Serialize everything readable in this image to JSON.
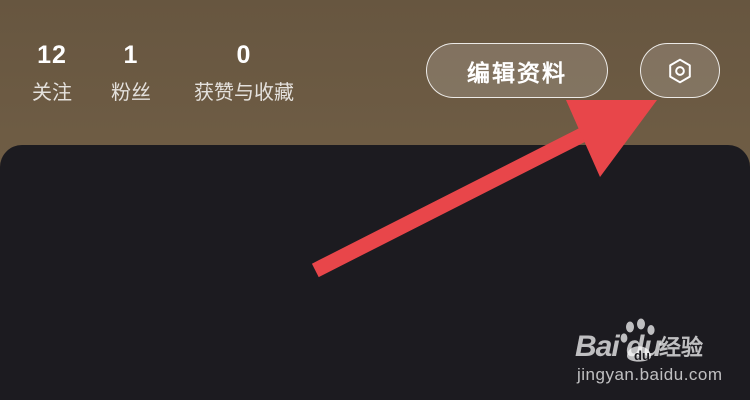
{
  "profile_stats": [
    {
      "count": "12",
      "label": "关注"
    },
    {
      "count": "1",
      "label": "粉丝"
    },
    {
      "count": "0",
      "label": "获赞与收藏"
    }
  ],
  "actions": {
    "edit_profile_label": "编辑资料",
    "settings_icon": "gear-icon"
  },
  "annotation": {
    "arrow_color": "#e8464a",
    "points_to": "settings-button"
  },
  "colors": {
    "header_background": "#6b5b44",
    "panel_background": "#1c1b20"
  },
  "watermark": {
    "logo_text": "Bai du",
    "product": "经验",
    "url": "jingyan.baidu.com"
  }
}
